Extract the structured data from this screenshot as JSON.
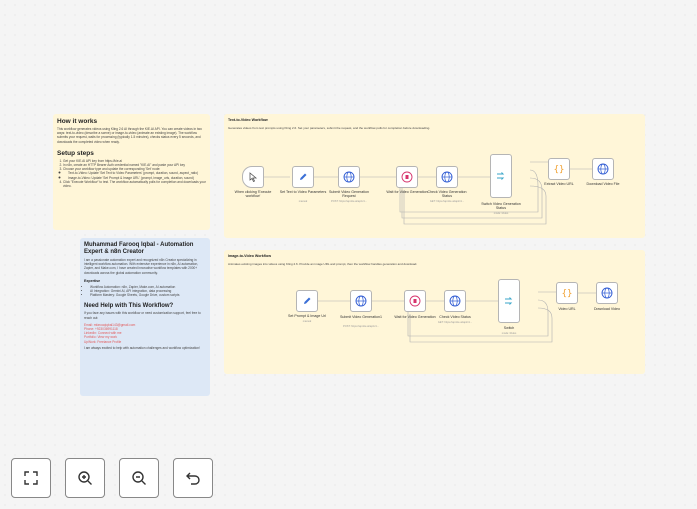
{
  "how": {
    "title": "How it works",
    "desc": "This workflow generates videos using Kling 2.6 AI through the KIE.AI API. You can create videos in two ways: text-to-video (describe a scene) or image-to-video (animate an existing image). The workflow submits your request, waits for processing (typically 1-5 minutes), checks status every 5 seconds, and downloads the completed video when ready.",
    "setup_title": "Setup steps",
    "steps": [
      "Get your KIE.AI API key from https://kie.ai",
      "In n8n, create an HTTP Bearer Auth credential named \"KIE.AI\" and paste your API key",
      "Choose your workflow type and update the corresponding 'Set' node:",
      "Click \"Execute Workflow\" to test. The workflow automatically polls for completion and downloads your video."
    ],
    "substeps": [
      "Text-to-Video: Update 'Set Text to Video Parameters' (prompt, duration, sound, aspect_ratio)",
      "Image-to-Video: Update 'Set Prompt & Image URL' (prompt, image_urls, duration, sound)"
    ]
  },
  "author": {
    "title": "Muhammad Farooq Iqbal - Automation Expert & n8n Creator",
    "bio": "I am a passionate automation expert and recognized n8n Creator specializing in intelligent workflow automation. With extensive experience in n8n, AI automation, Zapier, and Make.com, I have created innovative workflow templates with 2000+ downloads across the global automation community.",
    "expertise_title": "Expertise",
    "expertise": [
      "Workflow Automation: n8n, Zapier, Make.com, AI automation",
      "AI Integration: Gemini AI, API integration, data processing",
      "Platform Mastery: Google Sheets, Google Drive, custom scripts"
    ],
    "help_title": "Need Help with This Workflow?",
    "help_text": "If you face any issues with this workflow or need customization support, feel free to reach out:",
    "contacts": [
      "Email: mfarooqiqbal143@gmail.com",
      "Phone: +923036991118",
      "LinkedIn: Connect with me",
      "Portfolio: View my work",
      "UpWork: Freelance Profile"
    ],
    "closing": "I am always excited to help with automation challenges and workflow optimization!"
  },
  "t2v": {
    "title": "Text-to-Video Workflow",
    "subtitle": "Generates videos from text prompts using Kling 2.6. Set your parameters, submit the request, and the workflow polls for completion before downloading.",
    "nodes": {
      "trigger": "When clicking 'Execute workflow'",
      "set": "Set Text to Video Parameters",
      "set_sub": "manual",
      "submit": "Submit Video Generation Request",
      "submit_sub": "POST: https://api.kie.ai/api/v1...",
      "wait": "Wait for Video Generation",
      "check": "Check Video Generation Status",
      "check_sub": "GET: https://api.kie.ai/api/v1...",
      "switch": "Switch Video Generation Status",
      "switch_sub": "mode: Rules",
      "extract": "Extract Video URL",
      "download": "Download Video File"
    }
  },
  "i2v": {
    "title": "Image-to-Video Workflow",
    "subtitle": "Animates existing images into videos using Kling 2.6. Provide an image URL and prompt, then the workflow handles generation and download.",
    "nodes": {
      "set": "Set Prompt & Image Url",
      "set_sub": "manual",
      "submit": "Submit Video Generation1",
      "submit_sub": "POST: https://api.kie.ai/api/v1...",
      "wait": "Wait for Video Generation",
      "check": "Check Video Status",
      "check_sub": "GET: https://api.kie.ai/api/v1...",
      "switch": "Switch",
      "switch_sub": "mode: Rules",
      "extract": "Video URL",
      "download": "Download Video"
    }
  },
  "controls": {
    "fit": "fit-view",
    "zoom_in": "zoom-in",
    "zoom_out": "zoom-out",
    "undo": "undo"
  },
  "colors": {
    "accent": "#e25a5a",
    "http_blue": "#2f5bd3",
    "set_blue": "#3b6fd6",
    "code_orange": "#f0a030",
    "wait_red": "#d6336c",
    "switch_teal": "#3aa6c9"
  }
}
